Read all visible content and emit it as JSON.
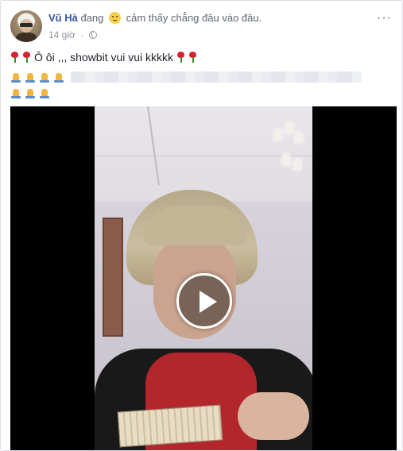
{
  "post": {
    "author": "Vũ Hà",
    "status_prefix": "đang",
    "status_text": "cảm thấy chẳng đâu vào đâu.",
    "time": "14 giờ",
    "separator": "·",
    "more_label": "···",
    "text_line1": "Ô ôi ,,, showbit vui vui kkkkk",
    "privacy_icon": "globe-icon"
  },
  "icons": {
    "rose": "rose-icon",
    "pray": "pray-icon",
    "feeling": "slightly-smiling-face-icon",
    "play": "play-icon"
  },
  "colors": {
    "author_link": "#365899",
    "meta_text": "#90949c",
    "video_bg": "#000000"
  }
}
